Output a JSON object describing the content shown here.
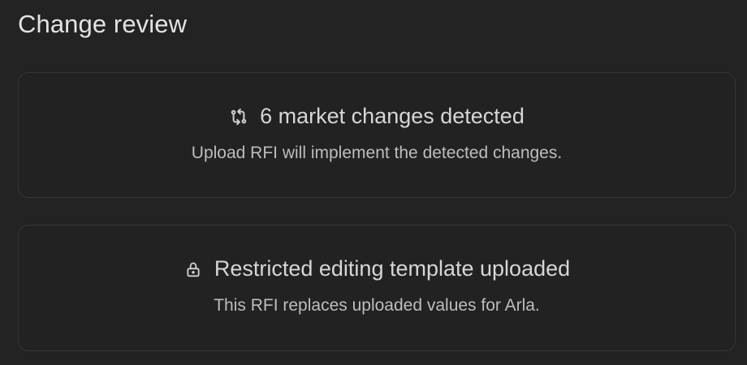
{
  "header": {
    "title": "Change review"
  },
  "cards": [
    {
      "icon": "compare-arrows-icon",
      "heading": "6 market changes detected",
      "body": "Upload RFI will implement the detected changes."
    },
    {
      "icon": "lock-icon",
      "heading": "Restricted editing template uploaded",
      "body": "This RFI replaces uploaded values for Arla."
    }
  ],
  "colors": {
    "background": "#232323",
    "card_border": "#363636",
    "title_text": "#e3e3e3",
    "heading_text": "#d6d6d6",
    "body_text": "#bdbdbd"
  }
}
